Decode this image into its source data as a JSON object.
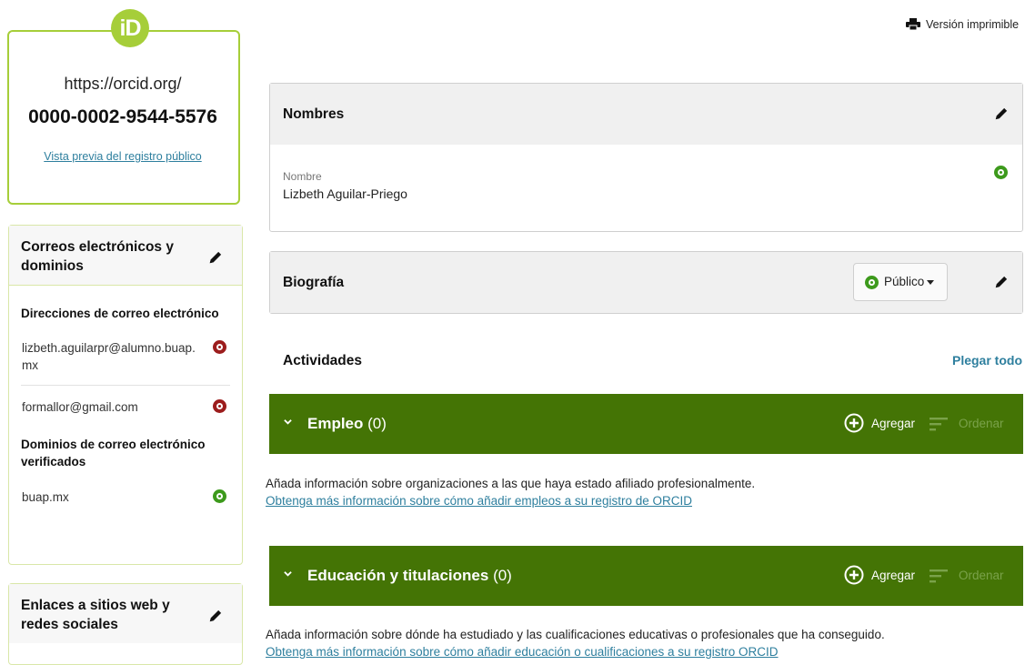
{
  "orcid_card": {
    "logo_text": "iD",
    "url_prefix": "https://orcid.org/",
    "orcid_id": "0000-0002-9544-5576",
    "preview_link": "Vista previa del registro público"
  },
  "emails_panel": {
    "title": "Correos electrónicos y dominios",
    "addresses_heading": "Direcciones de correo electrónico",
    "addresses": [
      {
        "email": "lizbeth.aguilarpr@alumno.buap.mx",
        "visibility": "private"
      },
      {
        "email": "formallor@gmail.com",
        "visibility": "private"
      }
    ],
    "domains_heading": "Dominios de correo electrónico verificados",
    "domains": [
      {
        "domain": "buap.mx",
        "visibility": "public"
      }
    ]
  },
  "websites_panel": {
    "title": "Enlaces a sitios web y redes sociales"
  },
  "print_link": "Versión imprimible",
  "names_section": {
    "title": "Nombres",
    "field_label": "Nombre",
    "field_value": "Lizbeth Aguilar-Priego",
    "visibility": "public"
  },
  "biography_section": {
    "title": "Biografía",
    "visibility_label": "Público"
  },
  "activities": {
    "title": "Actividades",
    "collapse_all": "Plegar todo",
    "sections": [
      {
        "title": "Empleo",
        "count": "(0)",
        "add_label": "Agregar",
        "sort_label": "Ordenar",
        "description": "Añada información sobre organizaciones a las que haya estado afiliado profesionalmente.",
        "learn_more": "Obtenga más información sobre cómo añadir empleos a su registro de ORCID"
      },
      {
        "title": "Educación y titulaciones",
        "count": "(0)",
        "add_label": "Agregar",
        "sort_label": "Ordenar",
        "description": "Añada información sobre dónde ha estudiado y las cualificaciones educativas o profesionales que ha conseguido.",
        "learn_more": "Obtenga más información sobre cómo añadir educación o cualificaciones a su registro ORCID"
      }
    ]
  },
  "colors": {
    "orcid_green": "#a6ce39",
    "section_bar": "#447405",
    "link": "#2e7f9e",
    "private": "#9c1d1d",
    "public": "#3d9a1c"
  }
}
